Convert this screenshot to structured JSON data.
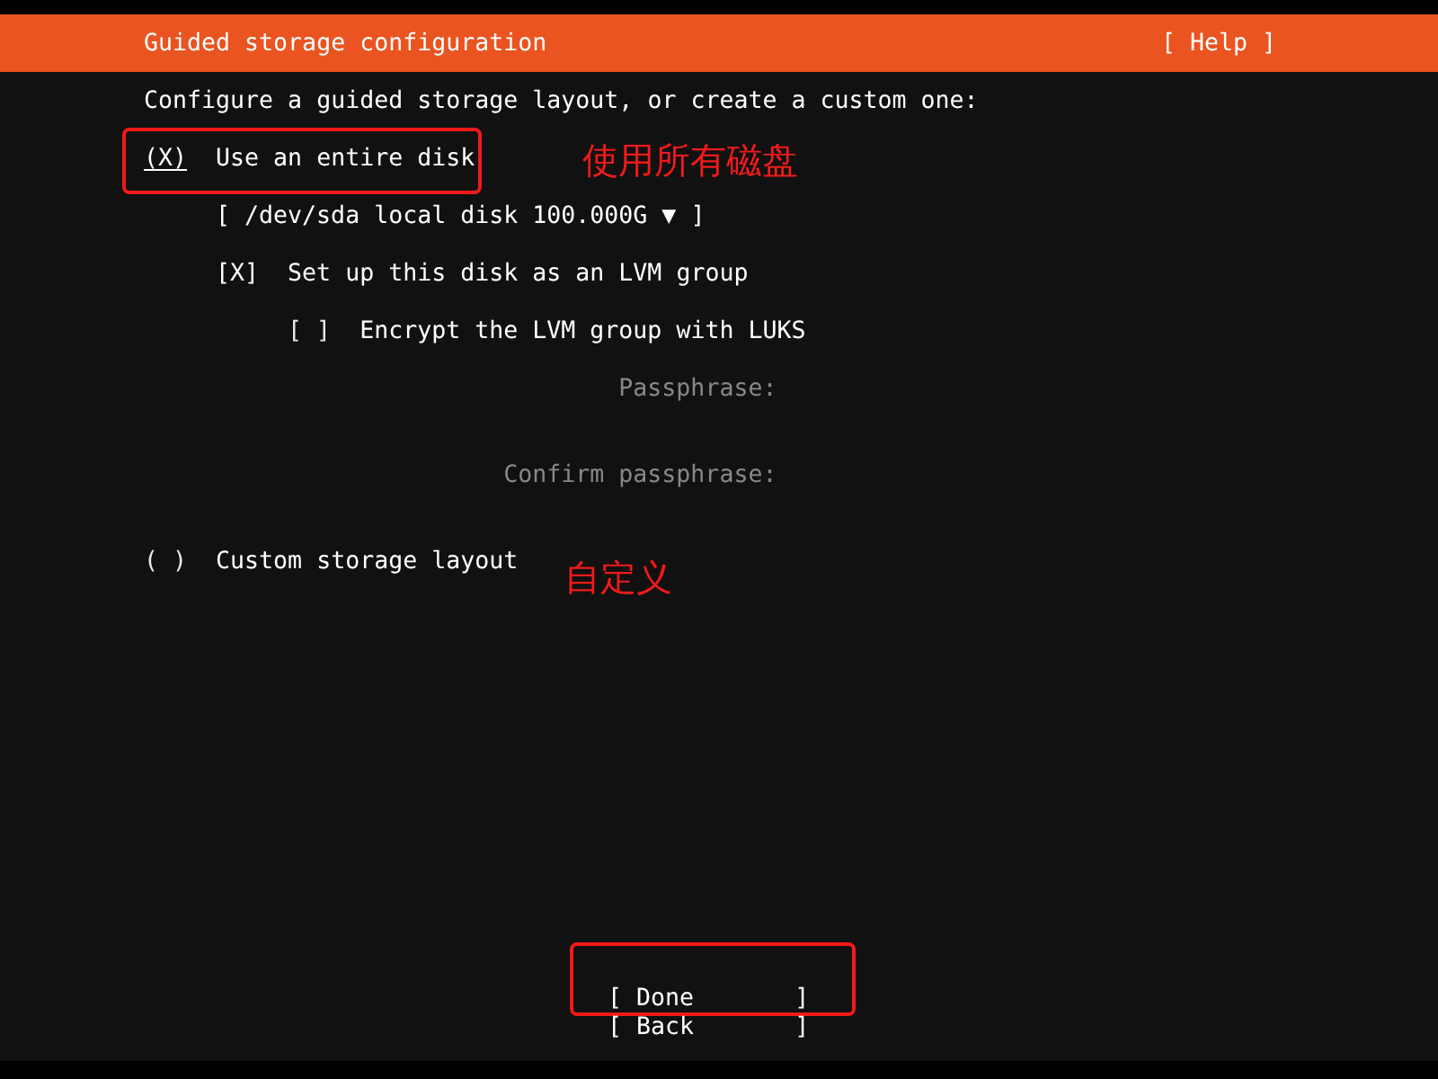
{
  "header": {
    "title": "Guided storage configuration",
    "help": "[ Help ]"
  },
  "intro": "Configure a guided storage layout, or create a custom one:",
  "options": [
    {
      "kind": "entire",
      "mark": "(X)",
      "selected": true,
      "focused": true,
      "label": "Use an entire disk",
      "highlighted": true,
      "note": "使用所有磁盘",
      "disk_select": "[ /dev/sda local disk 100.000G ▼ ]",
      "lvm": {
        "mark": "[X]",
        "checked": true,
        "label": "Set up this disk as an LVM group",
        "encrypt": {
          "mark": "[ ]",
          "checked": false,
          "label": "Encrypt the LVM group with LUKS",
          "fields": [
            {
              "label": "Passphrase:",
              "disabled": true
            },
            {
              "label": "Confirm passphrase:",
              "disabled": true
            }
          ]
        }
      }
    },
    {
      "kind": "custom",
      "mark": "( )",
      "selected": false,
      "focused": false,
      "label": "Custom storage layout",
      "highlighted": false,
      "note": "自定义"
    }
  ],
  "buttons": [
    {
      "label": "[ Done       ]",
      "highlighted": true
    },
    {
      "label": "[ Back       ]",
      "highlighted": false
    }
  ]
}
